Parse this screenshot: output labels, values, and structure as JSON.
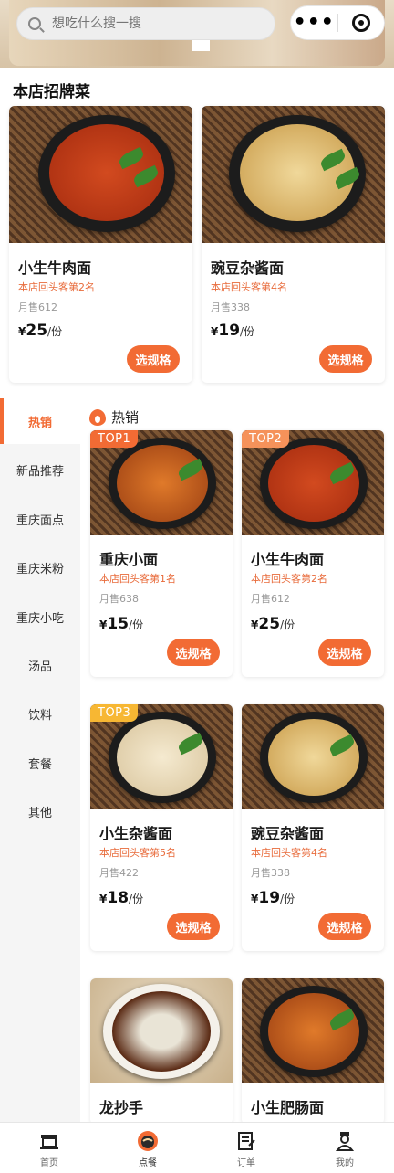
{
  "search": {
    "placeholder": "想吃什么搜一搜"
  },
  "capsule": {
    "more": "•••"
  },
  "signature": {
    "title": "本店招牌菜",
    "items": [
      {
        "name": "小生牛肉面",
        "rank": "本店回头客第2名",
        "sold": "月售612",
        "price": "25",
        "unit": "/份",
        "button": "选规格"
      },
      {
        "name": "豌豆杂酱面",
        "rank": "本店回头客第4名",
        "sold": "月售338",
        "price": "19",
        "unit": "/份",
        "button": "选规格"
      }
    ]
  },
  "sidebar": {
    "items": [
      {
        "label": "热销",
        "active": true
      },
      {
        "label": "新品推荐"
      },
      {
        "label": "重庆面点"
      },
      {
        "label": "重庆米粉"
      },
      {
        "label": "重庆小吃"
      },
      {
        "label": "汤品"
      },
      {
        "label": "饮料"
      },
      {
        "label": "套餐"
      },
      {
        "label": "其他"
      }
    ]
  },
  "category": {
    "title": "热销",
    "products": [
      {
        "badge": "TOP1",
        "badge_color": "#f26b34",
        "name": "重庆小面",
        "rank": "本店回头客第1名",
        "sold": "月售638",
        "price": "15",
        "unit": "/份",
        "button": "选规格"
      },
      {
        "badge": "TOP2",
        "badge_color": "#f5925a",
        "name": "小生牛肉面",
        "rank": "本店回头客第2名",
        "sold": "月售612",
        "price": "25",
        "unit": "/份",
        "button": "选规格"
      },
      {
        "badge": "TOP3",
        "badge_color": "#f7b733",
        "name": "小生杂酱面",
        "rank": "本店回头客第5名",
        "sold": "月售422",
        "price": "18",
        "unit": "/份",
        "button": "选规格"
      },
      {
        "badge": "",
        "name": "豌豆杂酱面",
        "rank": "本店回头客第4名",
        "sold": "月售338",
        "price": "19",
        "unit": "/份",
        "button": "选规格"
      },
      {
        "badge": "",
        "name": "龙抄手",
        "rank": "",
        "sold": "",
        "price": "",
        "unit": "",
        "button": ""
      },
      {
        "badge": "",
        "name": "小生肥肠面",
        "rank": "",
        "sold": "",
        "price": "",
        "unit": "",
        "button": ""
      }
    ]
  },
  "currency": "¥",
  "tabbar": [
    {
      "label": "首页",
      "icon": "home-icon"
    },
    {
      "label": "点餐",
      "icon": "order-food-icon",
      "active": true
    },
    {
      "label": "订单",
      "icon": "orders-icon"
    },
    {
      "label": "我的",
      "icon": "profile-icon"
    }
  ]
}
